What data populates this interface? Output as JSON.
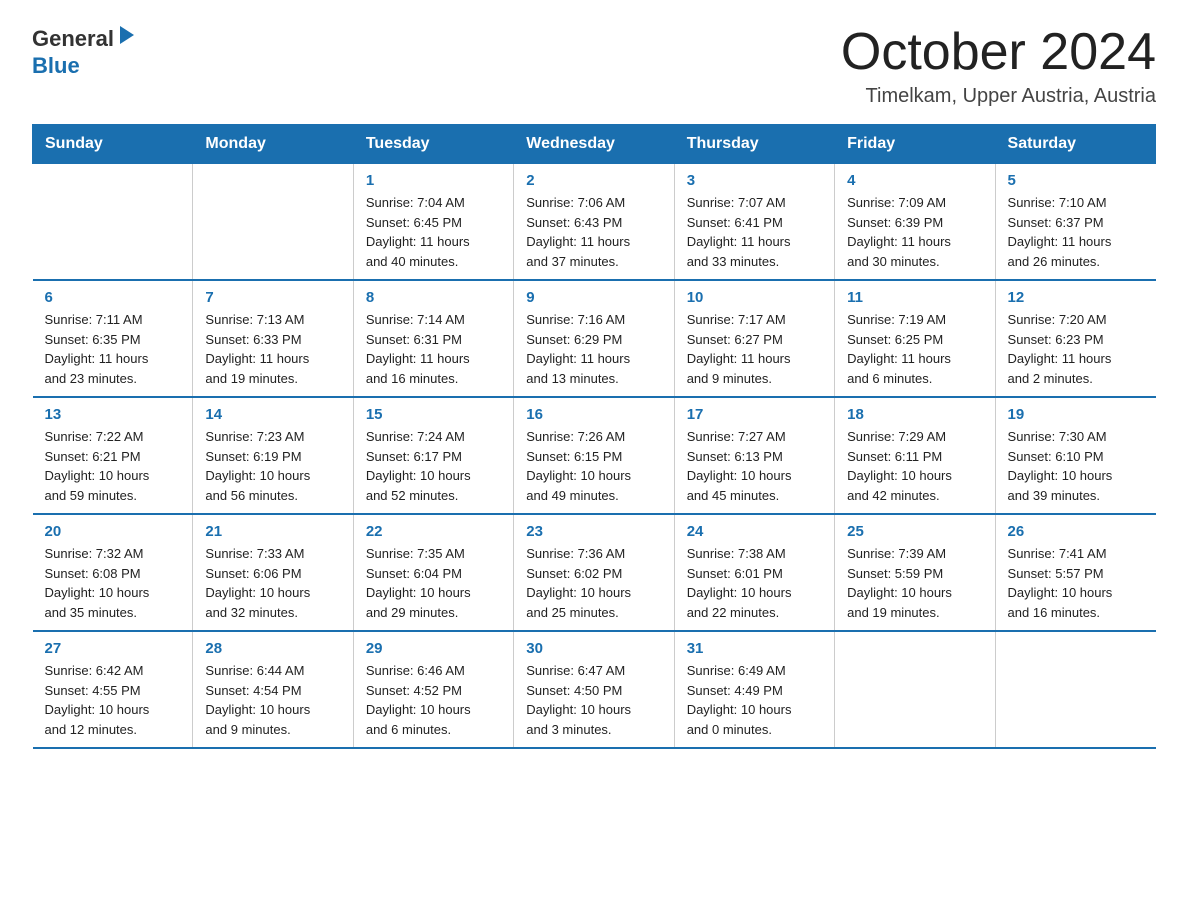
{
  "logo": {
    "general": "General",
    "triangle": "▶",
    "blue": "Blue"
  },
  "header": {
    "title": "October 2024",
    "subtitle": "Timelkam, Upper Austria, Austria"
  },
  "weekdays": [
    "Sunday",
    "Monday",
    "Tuesday",
    "Wednesday",
    "Thursday",
    "Friday",
    "Saturday"
  ],
  "weeks": [
    [
      {
        "day": "",
        "info": ""
      },
      {
        "day": "",
        "info": ""
      },
      {
        "day": "1",
        "info": "Sunrise: 7:04 AM\nSunset: 6:45 PM\nDaylight: 11 hours\nand 40 minutes."
      },
      {
        "day": "2",
        "info": "Sunrise: 7:06 AM\nSunset: 6:43 PM\nDaylight: 11 hours\nand 37 minutes."
      },
      {
        "day": "3",
        "info": "Sunrise: 7:07 AM\nSunset: 6:41 PM\nDaylight: 11 hours\nand 33 minutes."
      },
      {
        "day": "4",
        "info": "Sunrise: 7:09 AM\nSunset: 6:39 PM\nDaylight: 11 hours\nand 30 minutes."
      },
      {
        "day": "5",
        "info": "Sunrise: 7:10 AM\nSunset: 6:37 PM\nDaylight: 11 hours\nand 26 minutes."
      }
    ],
    [
      {
        "day": "6",
        "info": "Sunrise: 7:11 AM\nSunset: 6:35 PM\nDaylight: 11 hours\nand 23 minutes."
      },
      {
        "day": "7",
        "info": "Sunrise: 7:13 AM\nSunset: 6:33 PM\nDaylight: 11 hours\nand 19 minutes."
      },
      {
        "day": "8",
        "info": "Sunrise: 7:14 AM\nSunset: 6:31 PM\nDaylight: 11 hours\nand 16 minutes."
      },
      {
        "day": "9",
        "info": "Sunrise: 7:16 AM\nSunset: 6:29 PM\nDaylight: 11 hours\nand 13 minutes."
      },
      {
        "day": "10",
        "info": "Sunrise: 7:17 AM\nSunset: 6:27 PM\nDaylight: 11 hours\nand 9 minutes."
      },
      {
        "day": "11",
        "info": "Sunrise: 7:19 AM\nSunset: 6:25 PM\nDaylight: 11 hours\nand 6 minutes."
      },
      {
        "day": "12",
        "info": "Sunrise: 7:20 AM\nSunset: 6:23 PM\nDaylight: 11 hours\nand 2 minutes."
      }
    ],
    [
      {
        "day": "13",
        "info": "Sunrise: 7:22 AM\nSunset: 6:21 PM\nDaylight: 10 hours\nand 59 minutes."
      },
      {
        "day": "14",
        "info": "Sunrise: 7:23 AM\nSunset: 6:19 PM\nDaylight: 10 hours\nand 56 minutes."
      },
      {
        "day": "15",
        "info": "Sunrise: 7:24 AM\nSunset: 6:17 PM\nDaylight: 10 hours\nand 52 minutes."
      },
      {
        "day": "16",
        "info": "Sunrise: 7:26 AM\nSunset: 6:15 PM\nDaylight: 10 hours\nand 49 minutes."
      },
      {
        "day": "17",
        "info": "Sunrise: 7:27 AM\nSunset: 6:13 PM\nDaylight: 10 hours\nand 45 minutes."
      },
      {
        "day": "18",
        "info": "Sunrise: 7:29 AM\nSunset: 6:11 PM\nDaylight: 10 hours\nand 42 minutes."
      },
      {
        "day": "19",
        "info": "Sunrise: 7:30 AM\nSunset: 6:10 PM\nDaylight: 10 hours\nand 39 minutes."
      }
    ],
    [
      {
        "day": "20",
        "info": "Sunrise: 7:32 AM\nSunset: 6:08 PM\nDaylight: 10 hours\nand 35 minutes."
      },
      {
        "day": "21",
        "info": "Sunrise: 7:33 AM\nSunset: 6:06 PM\nDaylight: 10 hours\nand 32 minutes."
      },
      {
        "day": "22",
        "info": "Sunrise: 7:35 AM\nSunset: 6:04 PM\nDaylight: 10 hours\nand 29 minutes."
      },
      {
        "day": "23",
        "info": "Sunrise: 7:36 AM\nSunset: 6:02 PM\nDaylight: 10 hours\nand 25 minutes."
      },
      {
        "day": "24",
        "info": "Sunrise: 7:38 AM\nSunset: 6:01 PM\nDaylight: 10 hours\nand 22 minutes."
      },
      {
        "day": "25",
        "info": "Sunrise: 7:39 AM\nSunset: 5:59 PM\nDaylight: 10 hours\nand 19 minutes."
      },
      {
        "day": "26",
        "info": "Sunrise: 7:41 AM\nSunset: 5:57 PM\nDaylight: 10 hours\nand 16 minutes."
      }
    ],
    [
      {
        "day": "27",
        "info": "Sunrise: 6:42 AM\nSunset: 4:55 PM\nDaylight: 10 hours\nand 12 minutes."
      },
      {
        "day": "28",
        "info": "Sunrise: 6:44 AM\nSunset: 4:54 PM\nDaylight: 10 hours\nand 9 minutes."
      },
      {
        "day": "29",
        "info": "Sunrise: 6:46 AM\nSunset: 4:52 PM\nDaylight: 10 hours\nand 6 minutes."
      },
      {
        "day": "30",
        "info": "Sunrise: 6:47 AM\nSunset: 4:50 PM\nDaylight: 10 hours\nand 3 minutes."
      },
      {
        "day": "31",
        "info": "Sunrise: 6:49 AM\nSunset: 4:49 PM\nDaylight: 10 hours\nand 0 minutes."
      },
      {
        "day": "",
        "info": ""
      },
      {
        "day": "",
        "info": ""
      }
    ]
  ]
}
